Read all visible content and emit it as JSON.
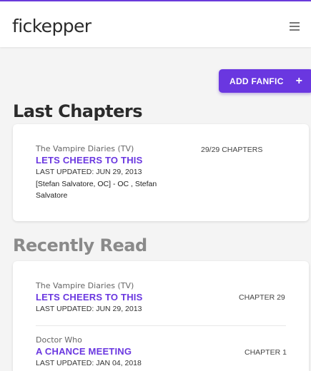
{
  "app": {
    "name": "fickepper"
  },
  "header": {
    "add_button_label": "ADD FANFIC",
    "add_button_icon": "+"
  },
  "sections": {
    "last_chapters": {
      "title": "Last Chapters",
      "items": [
        {
          "fandom": "The Vampire Diaries (TV)",
          "title": "LETS CHEERS TO THIS",
          "updated": "LAST UPDATED: JUN 29, 2013",
          "characters": "[Stefan Salvatore, OC] - OC , Stefan Salvatore",
          "chapters": "29/29 CHAPTERS"
        }
      ]
    },
    "recently_read": {
      "title": "Recently Read",
      "items": [
        {
          "fandom": "The Vampire Diaries (TV)",
          "title": "LETS CHEERS TO THIS",
          "updated": "LAST UPDATED: JUN 29, 2013",
          "chapter": "CHAPTER 29"
        },
        {
          "fandom": "Doctor Who",
          "title": "A CHANCE MEETING",
          "updated": "LAST UPDATED: JAN 04, 2018",
          "chapter": "CHAPTER 1"
        }
      ]
    }
  },
  "colors": {
    "accent": "#6a37e0",
    "background": "#f4f4f4"
  }
}
